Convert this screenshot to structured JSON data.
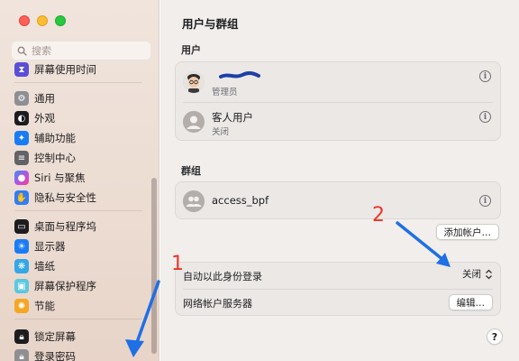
{
  "sidebar": {
    "search_placeholder": "搜索",
    "items": [
      {
        "label": "屏幕使用时间",
        "icon": "hourglass-icon",
        "color": "#5b4fd6"
      },
      {
        "label": "通用",
        "icon": "gear-icon",
        "color": "#8e8e93"
      },
      {
        "label": "外观",
        "icon": "appearance-icon",
        "color": "#1d1d1f"
      },
      {
        "label": "辅助功能",
        "icon": "accessibility-icon",
        "color": "#1a7cf5"
      },
      {
        "label": "控制中心",
        "icon": "control-center-icon",
        "color": "#636366"
      },
      {
        "label": "Siri 与聚焦",
        "icon": "siri-icon",
        "color": "#c44ce0"
      },
      {
        "label": "隐私与安全性",
        "icon": "hand-icon",
        "color": "#2f7ef6"
      },
      {
        "label": "桌面与程序坞",
        "icon": "dock-icon",
        "color": "#1d1d1f"
      },
      {
        "label": "显示器",
        "icon": "sun-icon",
        "color": "#1a7cf5"
      },
      {
        "label": "墙纸",
        "icon": "wallpaper-icon",
        "color": "#33a7e8"
      },
      {
        "label": "屏幕保护程序",
        "icon": "screensaver-icon",
        "color": "#5ac8e0"
      },
      {
        "label": "节能",
        "icon": "bulb-icon",
        "color": "#f5a623"
      },
      {
        "label": "锁定屏幕",
        "icon": "lock-icon",
        "color": "#1d1d1f"
      },
      {
        "label": "登录密码",
        "icon": "lock-icon",
        "color": "#8e8e93"
      }
    ]
  },
  "main": {
    "title": "用户与群组",
    "users_section": "用户",
    "users": [
      {
        "name": "",
        "role": "管理员",
        "avatar": "memoji-avatar"
      },
      {
        "name": "客人用户",
        "role": "关闭",
        "avatar": "person-avatar"
      }
    ],
    "groups_section": "群组",
    "groups": [
      {
        "name": "access_bpf",
        "avatar": "group-avatar"
      }
    ],
    "add_account_button": "添加帐户…",
    "auto_login_label": "自动以此身份登录",
    "auto_login_value": "关闭",
    "network_server_label": "网络帐户服务器",
    "edit_button": "编辑…",
    "help_button": "?",
    "info_glyph": "i"
  },
  "annotations": {
    "marker_1": "1",
    "marker_2": "2",
    "color": "#1f6fe5"
  }
}
